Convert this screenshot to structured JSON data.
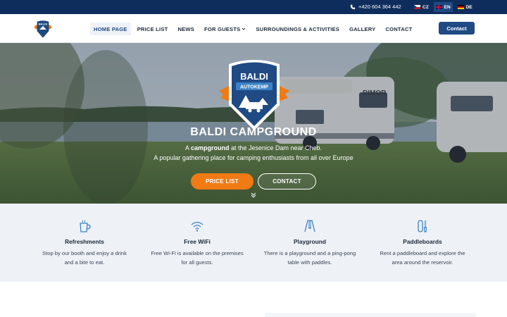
{
  "topbar": {
    "phone": "+420 604 364 442",
    "languages": [
      {
        "code": "CZ",
        "active": false
      },
      {
        "code": "EN",
        "active": true
      },
      {
        "code": "DE",
        "active": false
      }
    ]
  },
  "nav": {
    "logo_text": "BALDI",
    "items": [
      {
        "label": "HOME PAGE",
        "active": true
      },
      {
        "label": "PRICE LIST"
      },
      {
        "label": "NEWS"
      },
      {
        "label": "FOR GUESTS",
        "has_dropdown": true
      },
      {
        "label": "SURROUNDINGS & ACTIVITIES"
      },
      {
        "label": "GALLERY"
      },
      {
        "label": "CONTACT"
      }
    ],
    "contact_button": "Contact"
  },
  "hero": {
    "logo_title": "BALDI",
    "logo_subtitle": "AUTOKEMP",
    "title": "BALDI CAMPGROUND",
    "line1_prefix": "A",
    "line1_bold": "campground",
    "line1_suffix": "at the Jesenice Dam near Cheb.",
    "line2": "A popular gathering place for camping enthusiasts from all over Europe",
    "btn_price": "PRICE LIST",
    "btn_contact": "CONTACT",
    "camper_brand": "RIMOR"
  },
  "features": [
    {
      "icon": "cup-icon",
      "title": "Refreshments",
      "desc1": "Stop by our booth and enjoy a drink",
      "desc2": "and a bite to eat."
    },
    {
      "icon": "wifi-icon",
      "title": "Free WiFi",
      "desc1": "Free Wi-Fi is available on the premises",
      "desc2": "for all guests."
    },
    {
      "icon": "playground-icon",
      "title": "Playground",
      "desc1": "There is a playground and a ping-pong",
      "desc2": "table with paddles."
    },
    {
      "icon": "paddle-icon",
      "title": "Paddleboards",
      "desc1": "Rent a paddleboard and explore the",
      "desc2": "area around the reservoir."
    }
  ],
  "colors": {
    "topbar": "#0f2d5c",
    "primary": "#1f4a84",
    "accent": "#f07a14",
    "features_bg": "#eef1f6"
  }
}
